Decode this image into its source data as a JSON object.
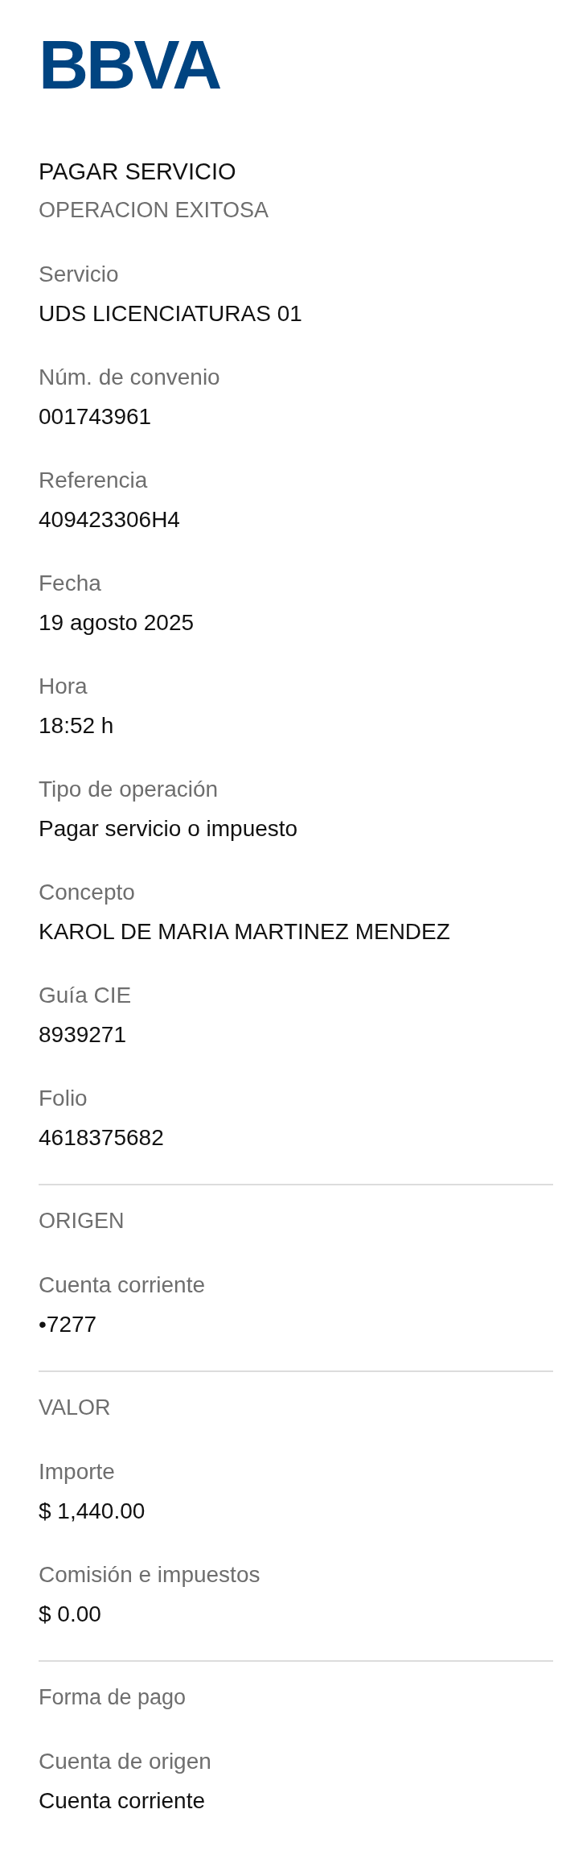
{
  "logo": "BBVA",
  "title": "PAGAR SERVICIO",
  "sections": [
    {
      "heading": "OPERACION EXITOSA",
      "fields": [
        {
          "label": "Servicio",
          "value": "UDS LICENCIATURAS 01"
        },
        {
          "label": "Núm. de convenio",
          "value": "001743961"
        },
        {
          "label": "Referencia",
          "value": "409423306H4"
        },
        {
          "label": "Fecha",
          "value": "19 agosto 2025"
        },
        {
          "label": "Hora",
          "value": "18:52 h"
        },
        {
          "label": "Tipo de operación",
          "value": "Pagar servicio o impuesto"
        },
        {
          "label": "Concepto",
          "value": "KAROL DE MARIA MARTINEZ MENDEZ"
        },
        {
          "label": "Guía CIE",
          "value": "8939271"
        },
        {
          "label": "Folio",
          "value": "4618375682"
        }
      ]
    },
    {
      "heading": "ORIGEN",
      "fields": [
        {
          "label": "Cuenta corriente",
          "value": "•7277"
        }
      ]
    },
    {
      "heading": "VALOR",
      "fields": [
        {
          "label": "Importe",
          "value": "$ 1,440.00"
        },
        {
          "label": "Comisión e impuestos",
          "value": "$ 0.00"
        }
      ]
    },
    {
      "heading": "Forma de pago",
      "fields": [
        {
          "label": "Cuenta de origen",
          "value": "Cuenta corriente"
        }
      ]
    }
  ]
}
